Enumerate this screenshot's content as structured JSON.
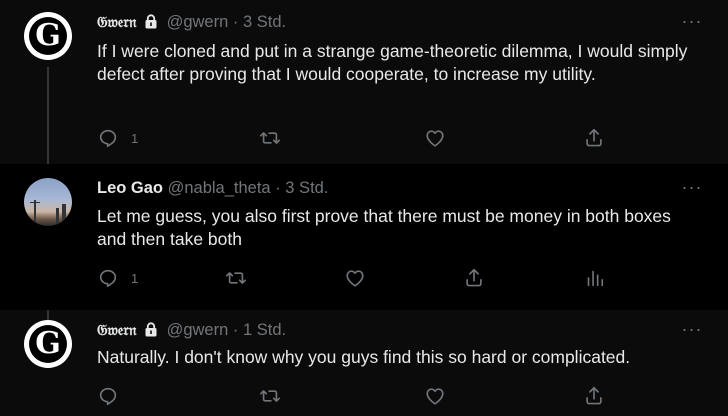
{
  "tweets": [
    {
      "name": "𝔊𝔴𝔢𝔯𝔫",
      "handle": "@gwern",
      "dot": "·",
      "time": "3 Std.",
      "text": "If I were cloned and put in a strange game-theoretic dilemma, I would simply defect after proving that I would cooperate, to increase my utility.",
      "reply_count": "1",
      "protected": true
    },
    {
      "name": "Leo Gao",
      "handle": "@nabla_theta",
      "dot": "·",
      "time": "3 Std.",
      "text": "Let me guess, you also first prove that there must be money in both boxes and then take both",
      "reply_count": "1",
      "protected": false
    },
    {
      "name": "𝔊𝔴𝔢𝔯𝔫",
      "handle": "@gwern",
      "dot": "·",
      "time": "1 Std.",
      "text": "Naturally. I don't know why you guys find this so hard or complicated.",
      "reply_count": "",
      "protected": true
    }
  ],
  "more_label": "···",
  "avatar_logo_glyph": "G",
  "colors": {
    "background": "#000000",
    "highlight_background": "#0b0b0b",
    "text": "#e7e9ea",
    "muted": "#71767b",
    "thread_line": "#333639"
  },
  "icons": [
    "reply-icon",
    "retweet-icon",
    "like-icon",
    "share-icon",
    "analytics-icon",
    "lock-icon",
    "more-icon"
  ]
}
